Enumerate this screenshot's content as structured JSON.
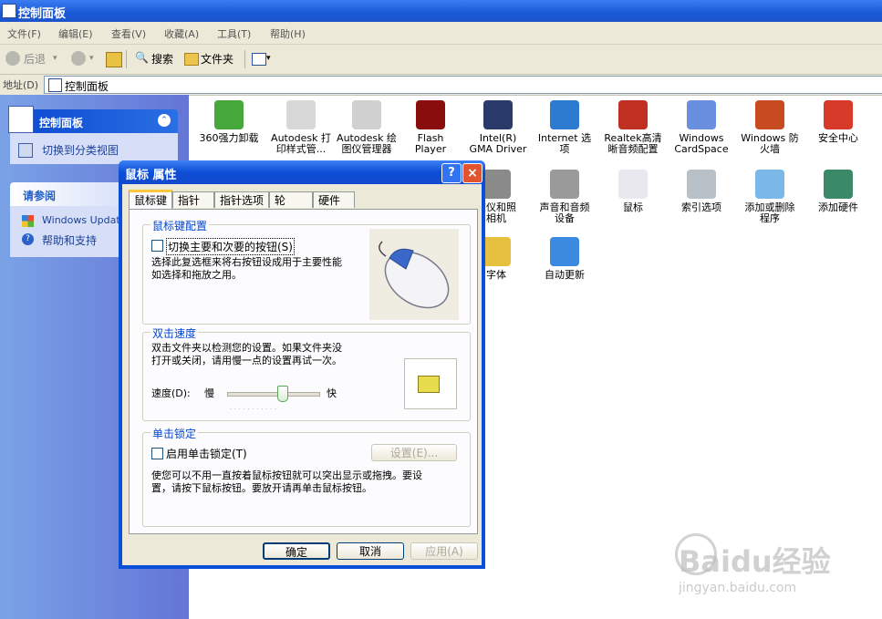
{
  "window": {
    "title": "控制面板"
  },
  "menu": [
    "文件(F)",
    "编辑(E)",
    "查看(V)",
    "收藏(A)",
    "工具(T)",
    "帮助(H)"
  ],
  "toolbar": {
    "back": "后退",
    "search": "搜索",
    "folders": "文件夹"
  },
  "address": {
    "label": "地址(D)",
    "value": "控制面板"
  },
  "leftpane": {
    "panel_title": "控制面板",
    "switch_view": "切换到分类视图",
    "see_also_title": "请参阅",
    "see_also": [
      "Windows Update",
      "帮助和支持"
    ]
  },
  "items_row1": [
    {
      "label": "360强力卸载",
      "icon": "uninstall-icon"
    },
    {
      "label": "Autodesk 打\n印样式管...",
      "icon": "printer-icon"
    },
    {
      "label": "Autodesk 绘\n图仪管理器",
      "icon": "plotter-icon"
    },
    {
      "label": "Flash\nPlayer",
      "icon": "flash-icon"
    },
    {
      "label": "Intel(R)\nGMA Driver",
      "icon": "monitor-icon"
    },
    {
      "label": "Internet 选\n项",
      "icon": "globe-icon"
    },
    {
      "label": "Realtek高清\n晰音频配置",
      "icon": "speaker-icon"
    },
    {
      "label": "Windows\nCardSpace",
      "icon": "cardspace-icon"
    },
    {
      "label": "Windows 防\n火墙",
      "icon": "firewall-icon"
    },
    {
      "label": "安全中心",
      "icon": "shield-icon"
    }
  ],
  "items_row2": [
    {
      "label": "描仪和照\n相机",
      "icon": "camera-icon"
    },
    {
      "label": "声音和音频\n设备",
      "icon": "sound-icon"
    },
    {
      "label": "鼠标",
      "icon": "mouse-icon"
    },
    {
      "label": "索引选项",
      "icon": "index-icon"
    },
    {
      "label": "添加或删除\n程序",
      "icon": "addremove-icon"
    },
    {
      "label": "添加硬件",
      "icon": "hardware-icon"
    }
  ],
  "items_row3": [
    {
      "label": "字体",
      "icon": "font-icon"
    },
    {
      "label": "自动更新",
      "icon": "windows-update-icon"
    }
  ],
  "dialog": {
    "title": "鼠标 属性",
    "help": "?",
    "close": "×",
    "tabs": [
      "鼠标键",
      "指针",
      "指针选项",
      "轮",
      "硬件"
    ],
    "group1": {
      "title": "鼠标键配置",
      "checkbox": "切换主要和次要的按钮(S)",
      "desc": "选择此复选框来将右按钮设成用于主要性能\n如选择和拖放之用。"
    },
    "group2": {
      "title": "双击速度",
      "desc": "双击文件夹以检测您的设置。如果文件夹没\n打开或关闭，请用慢一点的设置再试一次。",
      "speed_label": "速度(D):",
      "slow": "慢",
      "fast": "快",
      "speed_value": 0.6
    },
    "group3": {
      "title": "单击锁定",
      "checkbox": "启用单击锁定(T)",
      "settings": "设置(E)...",
      "desc": "使您可以不用一直按着鼠标按钮就可以突出显示或拖拽。要设\n置，请按下鼠标按钮。要放开请再单击鼠标按钮。"
    },
    "ok": "确定",
    "cancel": "取消",
    "apply": "应用(A)"
  },
  "watermark": {
    "brand": "Baidu经验",
    "url": "jingyan.baidu.com"
  }
}
